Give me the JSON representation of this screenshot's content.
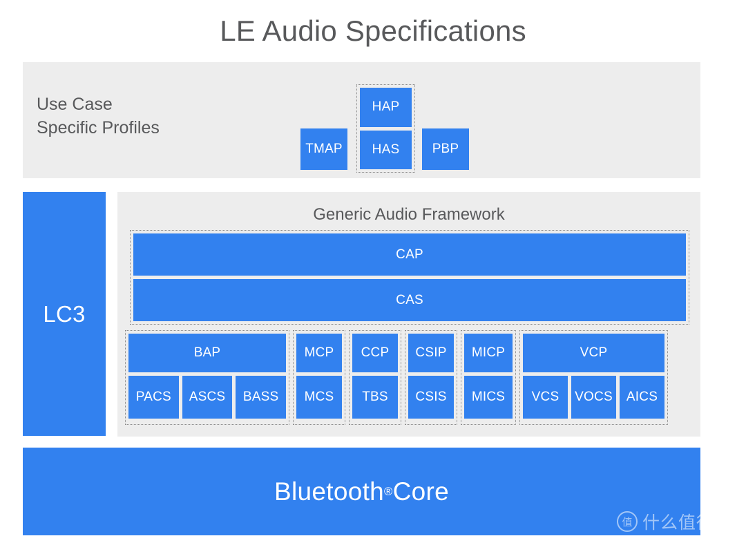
{
  "title": "LE Audio Specifications",
  "use_case_section": {
    "label": "Use Case\nSpecific Profiles",
    "tmap": "TMAP",
    "hap_group": {
      "top": "HAP",
      "bottom": "HAS"
    },
    "pbp": "PBP"
  },
  "codec": {
    "label": "LC3"
  },
  "generic_audio_framework": {
    "title": "Generic Audio Framework",
    "cap_group": {
      "cap": "CAP",
      "cas": "CAS"
    },
    "profile_groups": [
      {
        "name": "bap-group",
        "top": "BAP",
        "children": [
          "PACS",
          "ASCS",
          "BASS"
        ]
      },
      {
        "name": "mcp-group",
        "top": "MCP",
        "children": [
          "MCS"
        ]
      },
      {
        "name": "ccp-group",
        "top": "CCP",
        "children": [
          "TBS"
        ]
      },
      {
        "name": "csip-group",
        "top": "CSIP",
        "children": [
          "CSIS"
        ]
      },
      {
        "name": "micp-group",
        "top": "MICP",
        "children": [
          "MICS"
        ]
      },
      {
        "name": "vcp-group",
        "top": "VCP",
        "children": [
          "VCS",
          "VOCS",
          "AICS"
        ]
      }
    ]
  },
  "core": {
    "label": "Bluetooth",
    "trademark": "®",
    "suffix": " Core"
  },
  "watermark": {
    "badge": "值",
    "text": "什么值得买"
  },
  "colors": {
    "blue": "#3281ef",
    "panel_gray": "#ededed",
    "text_gray": "#58595b",
    "dotted_border": "#8a8a8a"
  }
}
